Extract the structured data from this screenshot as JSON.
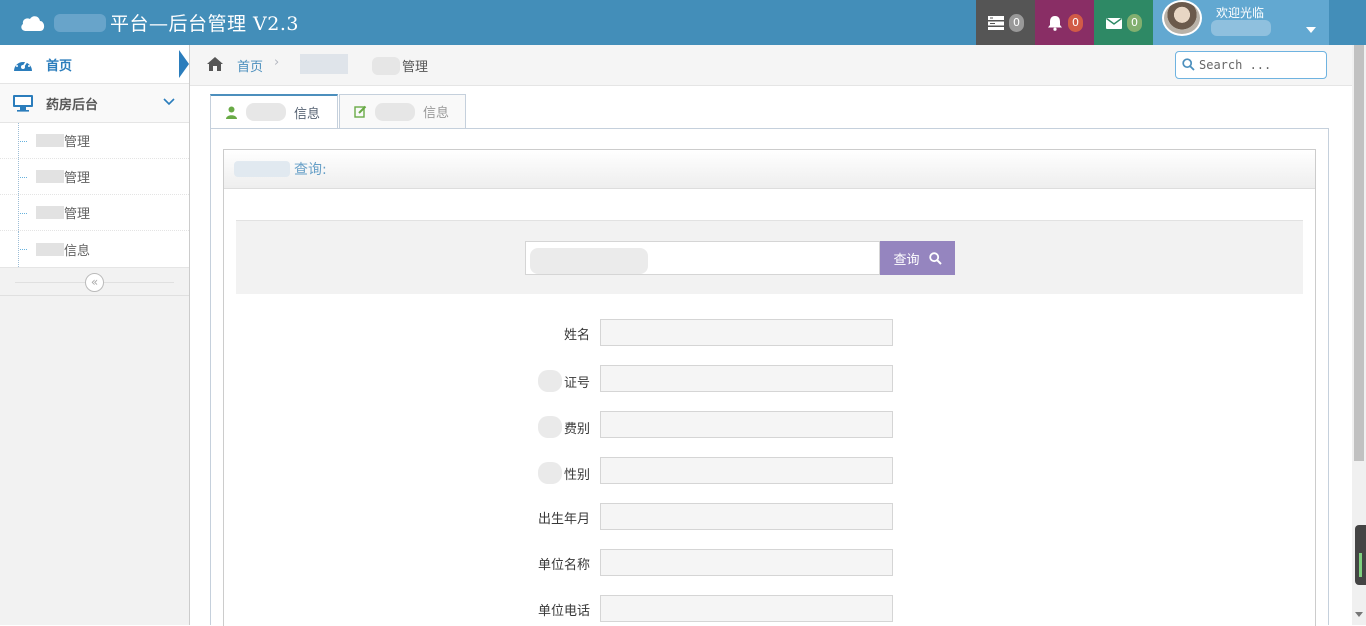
{
  "navbar": {
    "title": "平台—后台管理 V2.3",
    "tasks_count": "0",
    "notifications_count": "0",
    "messages_count": "0",
    "welcome": "欢迎光临"
  },
  "sidebar": {
    "home_label": "首页",
    "group_label": "药房后台",
    "sub_items": [
      {
        "label": "管理"
      },
      {
        "label": "管理"
      },
      {
        "label": "管理"
      },
      {
        "label": "信息"
      }
    ]
  },
  "breadcrumbs": {
    "home": "首页",
    "current": "管理"
  },
  "search": {
    "placeholder": "Search ..."
  },
  "tabs": [
    {
      "label": "信息"
    },
    {
      "label": "信息"
    }
  ],
  "widget": {
    "title": "查询:",
    "query_button": "查询"
  },
  "form": {
    "fields": [
      {
        "label": "姓名"
      },
      {
        "label": "证号"
      },
      {
        "label": "费别"
      },
      {
        "label": "性别"
      },
      {
        "label": "出生年月"
      },
      {
        "label": "单位名称"
      },
      {
        "label": "单位电话"
      }
    ]
  },
  "colors": {
    "navbar": "#438eb9",
    "accent": "#2b7dbc",
    "query_button": "#9585bf"
  }
}
